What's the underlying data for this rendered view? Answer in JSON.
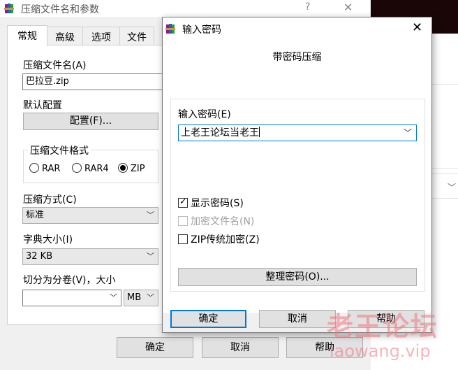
{
  "bg_window": {
    "title": "压缩文件名和参数",
    "help_glyph": "?",
    "close_glyph": "✕",
    "tabs": [
      "常规",
      "高级",
      "选项",
      "文件"
    ],
    "archive_name_label": "压缩文件名(A)",
    "archive_name_value": "巴拉豆.zip",
    "profile_label": "默认配置",
    "profile_button": "配置(F)...",
    "format_group_label": "压缩文件格式",
    "format_options": [
      "RAR",
      "RAR4",
      "ZIP"
    ],
    "format_selected": "ZIP",
    "method_label": "压缩方式(C)",
    "method_value": "标准",
    "dict_label": "字典大小(I)",
    "dict_value": "32 KB",
    "split_label": "切分为分卷(V)，大小",
    "split_value": "",
    "split_unit": "MB",
    "ok_button": "确定",
    "cancel_button": "取消",
    "help_button": "帮助"
  },
  "dialog": {
    "title": "输入密码",
    "close_glyph": "✕",
    "heading": "带密码压缩",
    "password_label": "输入密码(E)",
    "password_value": "上老王论坛当老王",
    "show_password_label": "显示密码(S)",
    "show_password_checked": true,
    "encrypt_names_label": "加密文件名(N)",
    "encrypt_names_checked": false,
    "zip_legacy_label": "ZIP传统加密(Z)",
    "zip_legacy_checked": false,
    "organize_button": "整理密码(O)...",
    "ok_button": "确定",
    "cancel_button": "取消",
    "help_button": "帮助"
  },
  "watermark": {
    "cn": "老王论坛",
    "en": "laowang.vip"
  },
  "colors": {
    "accent": "#0078d7",
    "watermark": "#ec7882"
  },
  "icons": {
    "app": "winrar-books-icon",
    "dropdown": "chevron-down-icon"
  }
}
